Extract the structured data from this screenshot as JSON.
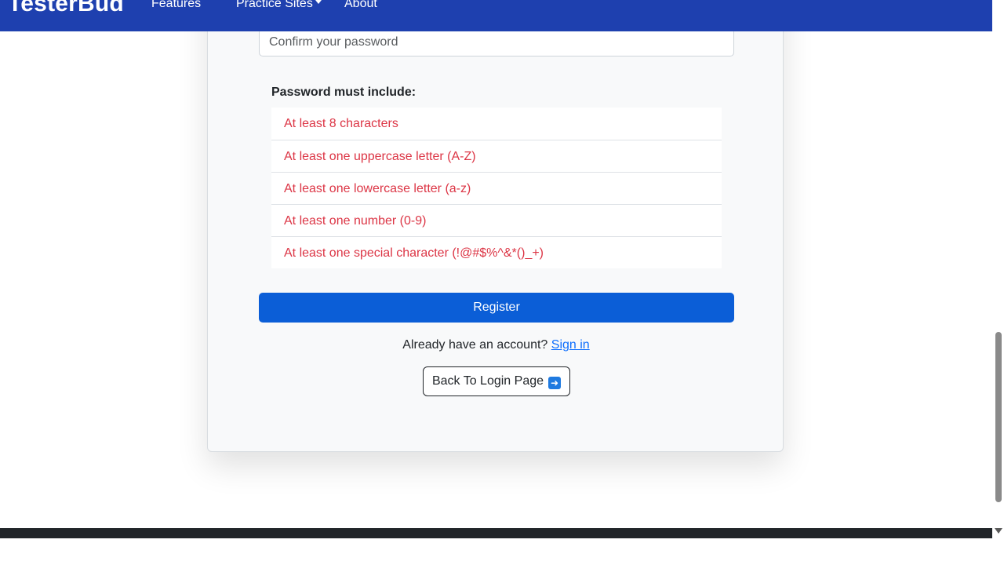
{
  "navbar": {
    "brand": "TesterBud",
    "links": {
      "features": "Features",
      "practice_sites": "Practice Sites",
      "about": "About"
    }
  },
  "form": {
    "confirm_password_placeholder": "Confirm your password",
    "requirements_title": "Password must include:",
    "requirements": [
      "At least 8 characters",
      "At least one uppercase letter (A-Z)",
      "At least one lowercase letter (a-z)",
      "At least one number (0-9)",
      "At least one special character (!@#$%^&*()_+)"
    ],
    "register_label": "Register",
    "signin_prompt": "Already have an account?",
    "signin_link": "Sign in",
    "back_label": "Back To Login Page",
    "back_icon": "right-arrow-emoji-icon"
  },
  "colors": {
    "navbar": "#1e40af",
    "register_button": "#0b5ed7",
    "requirement_unmet": "#dc3545",
    "link": "#0d6efd",
    "card_background": "#f8f9fa",
    "footer": "#212529"
  }
}
